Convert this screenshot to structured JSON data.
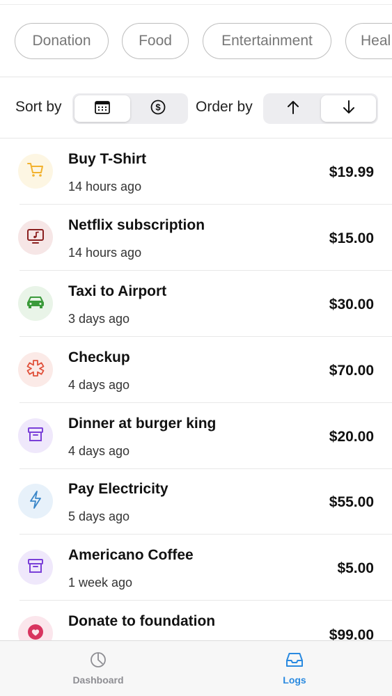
{
  "filters": {
    "chips": [
      "Donation",
      "Food",
      "Entertainment",
      "Heal"
    ]
  },
  "sort": {
    "sort_label": "Sort by",
    "sort_options": [
      "calendar-icon",
      "dollar-circle-icon"
    ],
    "order_label": "Order by",
    "order_options": [
      "arrow-up-icon",
      "arrow-down-icon"
    ]
  },
  "transactions": [
    {
      "title": "Buy T-Shirt",
      "time": "14 hours ago",
      "amount": "$19.99",
      "icon": "cart-icon",
      "color": "#f2b22e",
      "bg": "#fdf6e3"
    },
    {
      "title": "Netflix subscription",
      "time": "14 hours ago",
      "amount": "$15.00",
      "icon": "tv-music-icon",
      "color": "#8b2020",
      "bg": "#f6e6e6"
    },
    {
      "title": "Taxi to Airport",
      "time": "3 days ago",
      "amount": "$30.00",
      "icon": "car-icon",
      "color": "#3a9a3a",
      "bg": "#e9f4e8"
    },
    {
      "title": "Checkup",
      "time": "4 days ago",
      "amount": "$70.00",
      "icon": "medical-icon",
      "color": "#e0503a",
      "bg": "#fbeae7"
    },
    {
      "title": "Dinner at burger king",
      "time": "4 days ago",
      "amount": "$20.00",
      "icon": "archive-box-icon",
      "color": "#7a3fd8",
      "bg": "#efe8fb"
    },
    {
      "title": "Pay Electricity",
      "time": "5 days ago",
      "amount": "$55.00",
      "icon": "bolt-icon",
      "color": "#3a86c8",
      "bg": "#e7f1fa"
    },
    {
      "title": "Americano Coffee",
      "time": "1 week ago",
      "amount": "$5.00",
      "icon": "archive-box-icon",
      "color": "#7a3fd8",
      "bg": "#efe8fb"
    },
    {
      "title": "Donate to foundation",
      "time": "",
      "amount": "$99.00",
      "icon": "heart-icon",
      "color": "#d8345f",
      "bg": "#fbe6ec"
    }
  ],
  "tabbar": {
    "dashboard_label": "Dashboard",
    "logs_label": "Logs",
    "active": "logs",
    "accent": "#2a8ae0",
    "inactive": "#8e8e93"
  }
}
